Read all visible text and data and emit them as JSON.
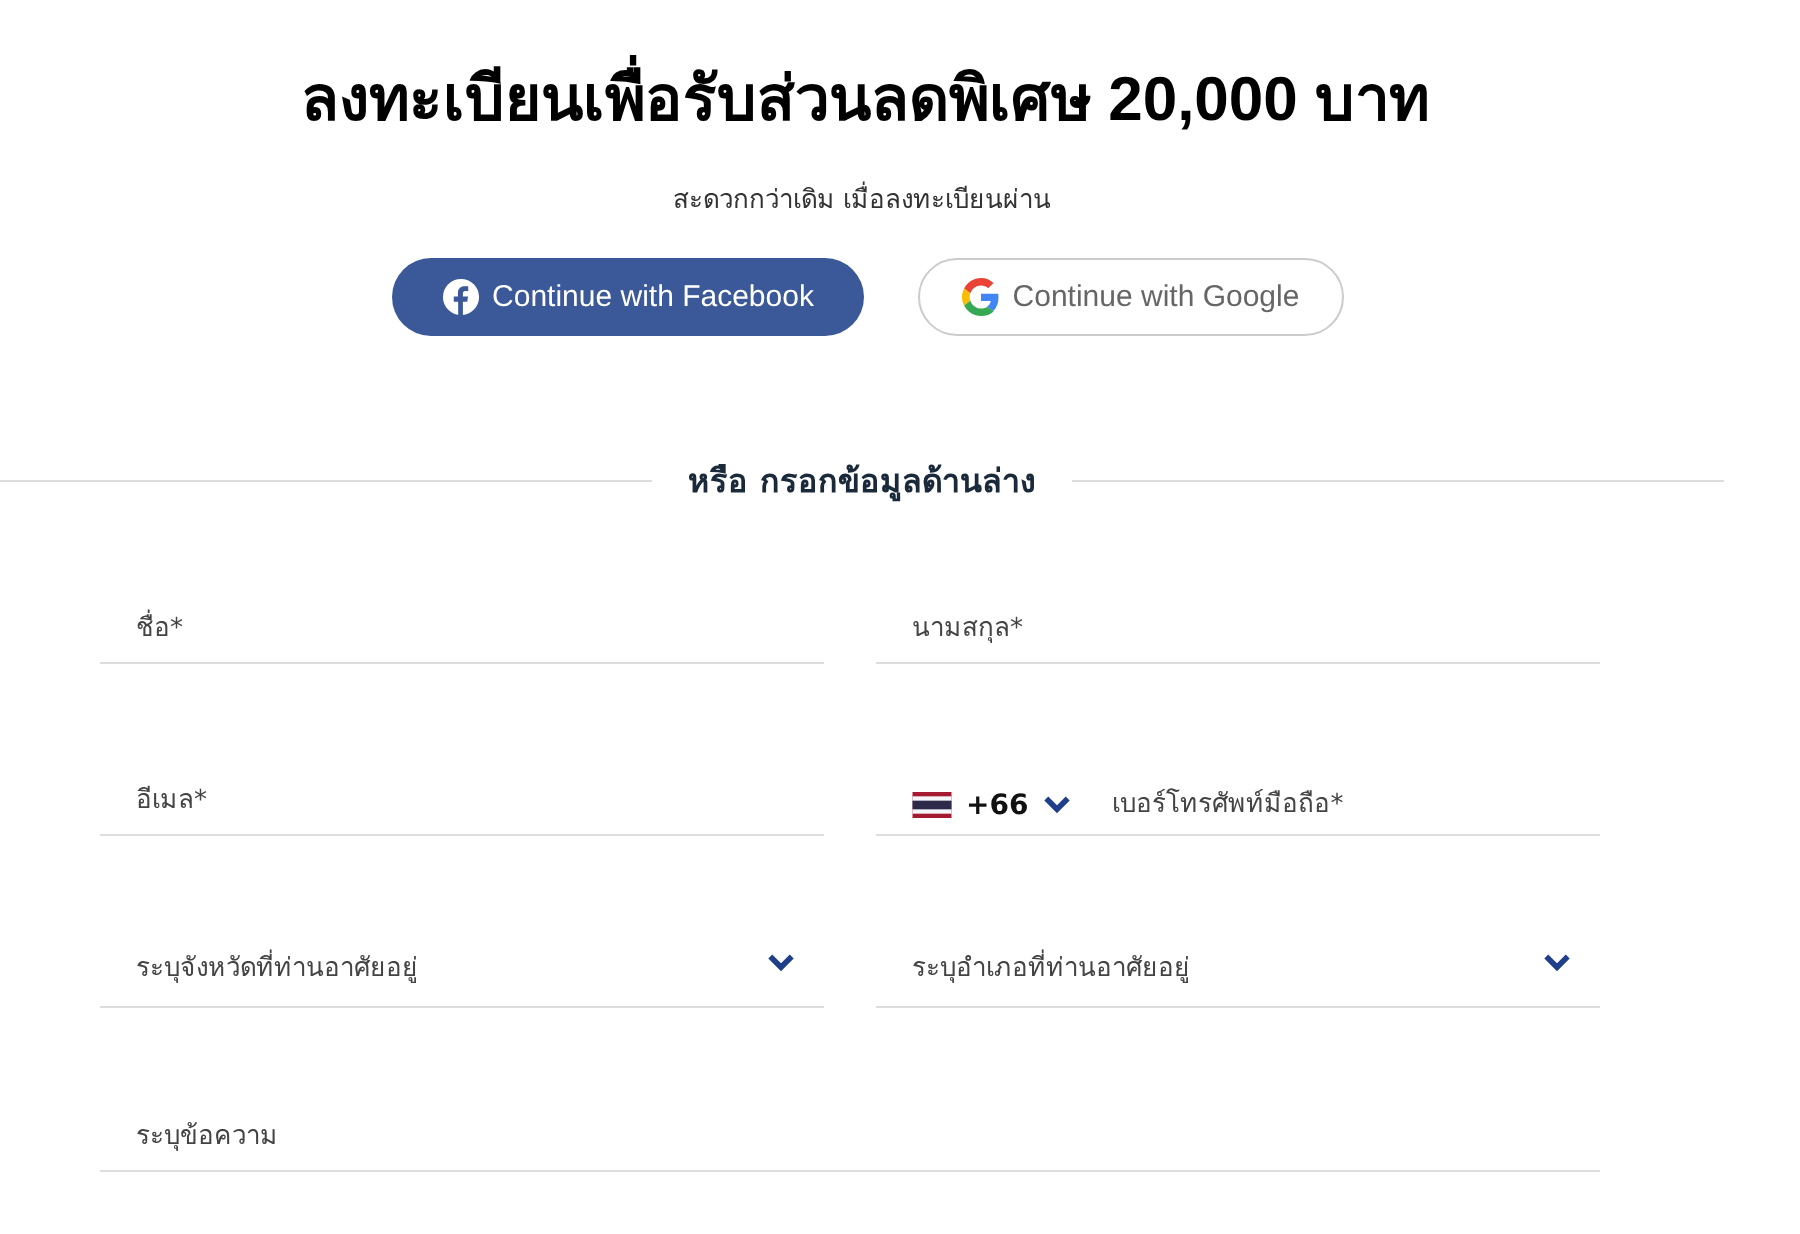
{
  "heading": "ลงทะเบียนเพื่อรับส่วนลดพิเศษ 20,000 บาท",
  "subheading": "สะดวกกว่าเดิม เมื่อลงทะเบียนผ่าน",
  "social_buttons": [
    {
      "kind": "facebook",
      "label": "Continue with Facebook"
    },
    {
      "kind": "google",
      "label": "Continue with Google"
    }
  ],
  "divider_text": "หรือ กรอกข้อมูลด้านล่าง",
  "fields": [
    {
      "kind": "text",
      "placeholder": "ชื่อ*"
    },
    {
      "kind": "text",
      "placeholder": "นามสกุล*"
    },
    {
      "kind": "text",
      "placeholder": "อีเมล*"
    },
    {
      "kind": "phone",
      "country_code": "+66",
      "placeholder": "เบอร์โทรศัพท์มือถือ*"
    },
    {
      "kind": "select",
      "placeholder": "ระบุจังหวัดที่ท่านอาศัยอยู่"
    },
    {
      "kind": "select",
      "placeholder": "ระบุอำเภอที่ท่านอาศัยอยู่"
    },
    {
      "kind": "message",
      "placeholder": "ระบุข้อความ"
    }
  ]
}
